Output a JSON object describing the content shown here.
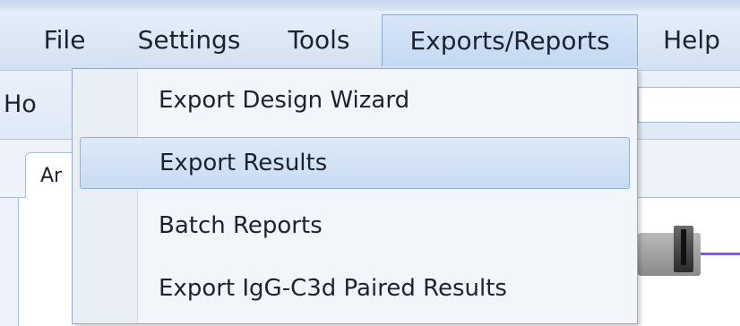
{
  "menubar": {
    "items": [
      {
        "label": "File"
      },
      {
        "label": "Settings"
      },
      {
        "label": "Tools"
      },
      {
        "label": "Exports/Reports"
      },
      {
        "label": "Help"
      }
    ],
    "active": "Exports/Reports"
  },
  "toolbar": {
    "home_tab_label": "Ho"
  },
  "content": {
    "tab_label": "Ar"
  },
  "dropdown": {
    "items": [
      {
        "label": "Export Design Wizard"
      },
      {
        "label": "Export Results"
      },
      {
        "label": "Batch Reports"
      },
      {
        "label": "Export IgG-C3d Paired Results"
      }
    ],
    "highlighted": "Export Results"
  },
  "colors": {
    "menubar_bg": "#dce7f5",
    "active_menu_bg": "#c4d9f2",
    "highlight_bg": "#c9dcf3",
    "highlight_border": "#8fb1dc"
  }
}
